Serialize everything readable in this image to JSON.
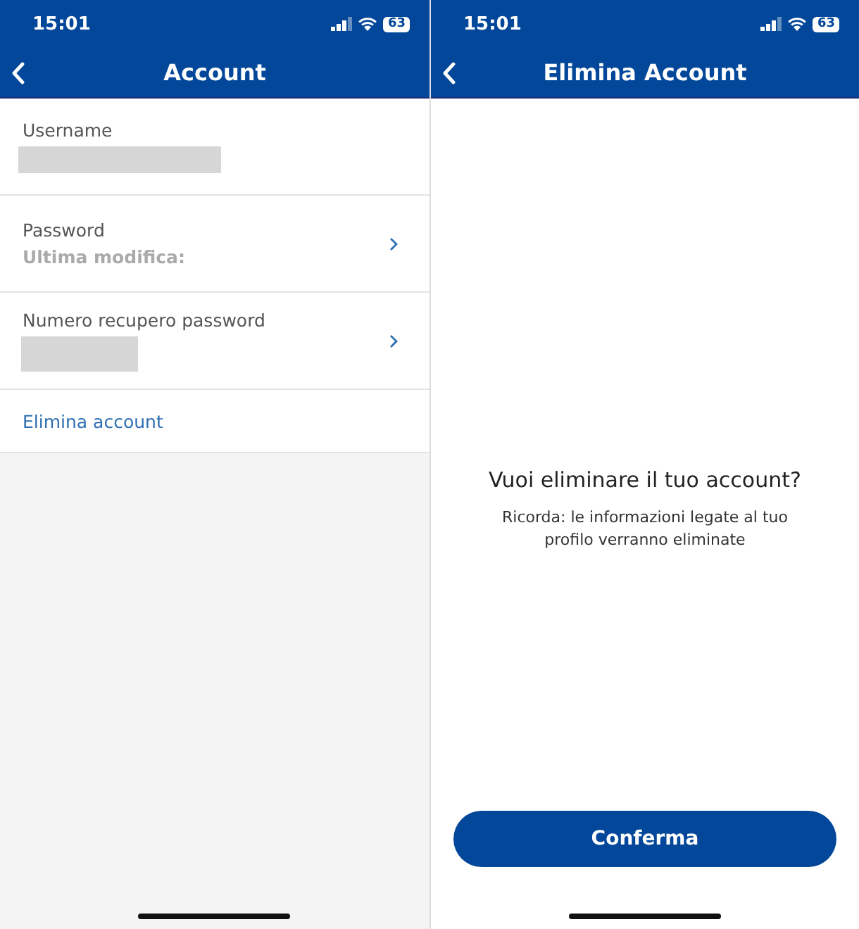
{
  "screens": [
    {
      "status_bar": {
        "time": "15:01",
        "battery": "63"
      },
      "nav": {
        "title": "Account"
      },
      "rows": [
        {
          "kind": "info",
          "label": "Username",
          "redacted": true,
          "chevron": false
        },
        {
          "kind": "info",
          "label": "Password",
          "detail": "Ultima modifica:",
          "chevron": true
        },
        {
          "kind": "info",
          "label": "Numero recupero password",
          "redacted": true,
          "chevron": true
        },
        {
          "kind": "link",
          "label": "Elimina account"
        }
      ]
    },
    {
      "status_bar": {
        "time": "15:01",
        "battery": "63"
      },
      "nav": {
        "title": "Elimina Account"
      },
      "dialog": {
        "heading": "Vuoi eliminare il tuo account?",
        "message": "Ricorda: le informazioni legate al tuo profilo verranno eliminate",
        "button": "Conferma"
      }
    }
  ]
}
